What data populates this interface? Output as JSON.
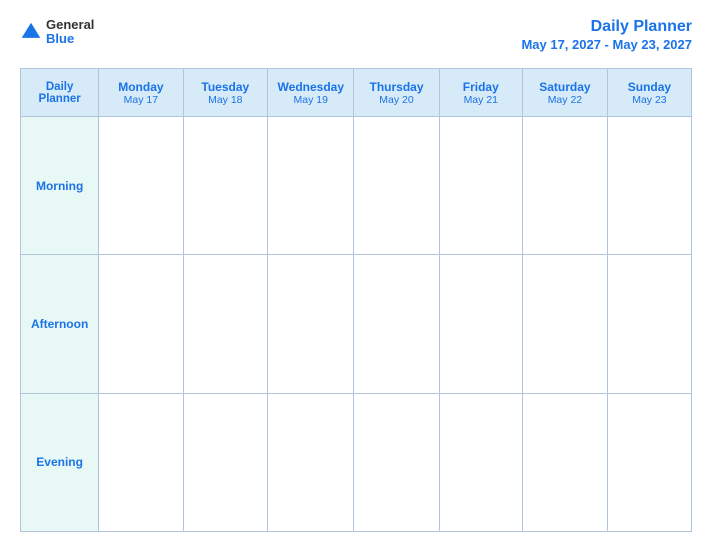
{
  "header": {
    "logo": {
      "general": "General",
      "blue": "Blue"
    },
    "title": "Daily Planner",
    "date_range": "May 17, 2027 - May 23, 2027"
  },
  "table": {
    "label_header_line1": "Daily",
    "label_header_line2": "Planner",
    "columns": [
      {
        "day": "Monday",
        "date": "May 17"
      },
      {
        "day": "Tuesday",
        "date": "May 18"
      },
      {
        "day": "Wednesday",
        "date": "May 19"
      },
      {
        "day": "Thursday",
        "date": "May 20"
      },
      {
        "day": "Friday",
        "date": "May 21"
      },
      {
        "day": "Saturday",
        "date": "May 22"
      },
      {
        "day": "Sunday",
        "date": "May 23"
      }
    ],
    "rows": [
      {
        "label": "Morning"
      },
      {
        "label": "Afternoon"
      },
      {
        "label": "Evening"
      }
    ]
  }
}
